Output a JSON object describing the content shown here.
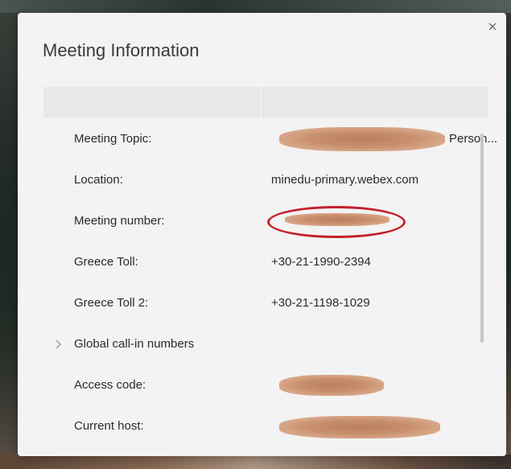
{
  "dialog": {
    "title": "Meeting Information",
    "close_icon": "close-icon"
  },
  "rows": [
    {
      "label": "Meeting Topic:",
      "value": "Person...",
      "redacted": true
    },
    {
      "label": "Location:",
      "value": "minedu-primary.webex.com",
      "redacted": false
    },
    {
      "label": "Meeting number:",
      "value": "",
      "redacted": true,
      "circled": true
    },
    {
      "label": "Greece Toll:",
      "value": "+30-21-1990-2394",
      "redacted": false
    },
    {
      "label": "Greece Toll 2:",
      "value": "+30-21-1198-1029",
      "redacted": false
    },
    {
      "label": "Global call-in numbers",
      "value": "",
      "expandable": true,
      "expander_icon": "chevron-right-icon"
    },
    {
      "label": "Access code:",
      "value": "",
      "redacted": true
    },
    {
      "label": "Current host:",
      "value": "",
      "redacted": true
    }
  ],
  "colors": {
    "dialog_bg": "#f3f3f3",
    "header_bg": "#e8e8e8",
    "annotation_red": "#c4202a",
    "redaction": "#c8906e"
  }
}
